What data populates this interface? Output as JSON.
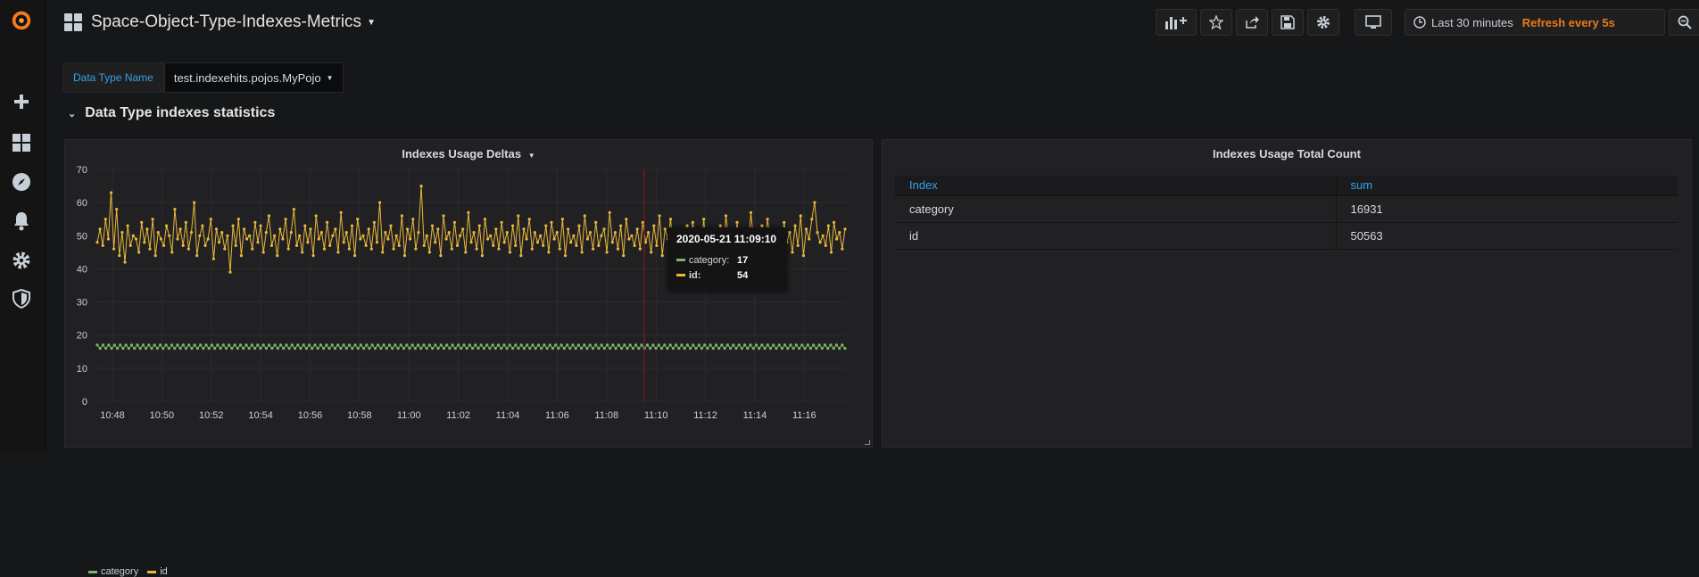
{
  "dashboard": {
    "title": "Space-Object-Type-Indexes-Metrics"
  },
  "topbar": {
    "time_range": "Last 30 minutes",
    "refresh": "Refresh every 5s"
  },
  "variables": {
    "label": "Data Type Name",
    "value": "test.indexehits.pojos.MyPojo"
  },
  "row": {
    "title": "Data Type indexes statistics"
  },
  "graph_panel": {
    "title": "Indexes Usage Deltas"
  },
  "table_panel": {
    "title": "Indexes Usage Total Count",
    "columns": [
      "Index",
      "sum"
    ],
    "rows": [
      [
        "category",
        "16931"
      ],
      [
        "id",
        "50563"
      ]
    ]
  },
  "tooltip": {
    "time": "2020-05-21 11:09:10",
    "rows": [
      {
        "name": "category:",
        "value": "17",
        "color": "#7eb26d"
      },
      {
        "name": "id:",
        "value": "54",
        "color": "#eab839"
      }
    ]
  },
  "colors": {
    "category": "#7eb26d",
    "id": "#eab839",
    "accent": "#33a2e5",
    "refresh": "#eb7b18"
  },
  "chart_data": {
    "type": "line",
    "title": "Indexes Usage Deltas",
    "x_ticks": [
      "10:48",
      "10:50",
      "10:52",
      "10:54",
      "10:56",
      "10:58",
      "11:00",
      "11:02",
      "11:04",
      "11:06",
      "11:08",
      "11:10",
      "11:12",
      "11:14",
      "11:16"
    ],
    "y_ticks": [
      0,
      10,
      20,
      30,
      40,
      50,
      60,
      70
    ],
    "ylim": [
      0,
      70
    ],
    "grid": true,
    "legend_position": "bottom-left",
    "series": [
      {
        "name": "category",
        "color": "#7eb26d",
        "values": [
          17,
          16,
          17,
          16,
          17,
          16,
          17,
          16,
          17,
          16,
          17,
          16,
          17,
          16,
          17,
          16,
          17,
          16,
          17,
          16,
          17,
          16,
          17,
          16,
          17,
          16,
          17,
          16,
          17,
          16,
          17,
          16,
          17,
          16,
          17,
          16,
          17,
          16,
          17,
          16,
          17,
          16,
          17,
          16,
          17,
          16,
          17,
          16,
          17,
          16,
          17,
          16,
          17,
          16,
          17,
          16,
          17,
          16,
          17,
          16,
          17,
          16,
          17,
          16,
          17,
          16,
          17,
          16,
          17,
          16,
          17,
          16,
          17,
          16,
          17,
          16,
          17,
          16,
          17,
          16,
          17,
          16,
          17,
          16,
          17,
          16,
          17,
          16,
          17,
          16,
          17,
          16,
          17,
          16,
          17,
          16,
          17,
          16,
          17,
          16,
          17,
          16,
          17,
          16,
          17,
          16,
          17,
          16,
          17,
          16,
          17,
          16,
          17,
          16,
          17,
          16,
          17,
          16,
          17,
          16,
          17,
          16,
          17,
          16,
          17,
          16,
          17,
          16,
          17,
          16,
          17,
          16,
          17,
          16,
          17,
          16,
          17,
          16,
          17,
          16,
          17,
          16,
          17,
          16,
          17,
          16,
          17,
          16,
          17,
          16,
          17,
          16,
          17,
          16,
          17,
          16,
          17,
          16,
          17,
          16,
          17,
          16,
          17,
          16,
          17,
          16,
          17,
          16,
          17,
          16,
          17,
          16,
          17,
          16,
          17,
          16,
          17,
          16,
          17,
          16,
          17,
          16,
          17,
          16,
          17,
          16,
          17,
          16,
          17,
          16,
          17,
          16,
          17,
          16,
          17,
          16,
          17,
          16,
          17,
          16,
          17,
          16,
          17,
          16,
          17,
          16,
          17,
          16,
          17,
          16,
          17,
          16,
          17,
          16,
          17,
          16,
          17,
          16,
          17,
          16,
          17,
          16,
          17,
          16,
          17,
          16,
          17,
          16,
          17,
          16,
          17,
          16,
          17,
          16,
          17,
          16,
          17,
          16,
          17,
          16,
          17,
          16,
          17,
          16,
          17,
          16,
          17,
          16,
          17,
          16,
          17,
          16,
          17,
          16,
          17,
          16,
          17,
          16,
          17,
          16,
          17,
          16
        ]
      },
      {
        "name": "id",
        "color": "#eab839",
        "values": [
          48,
          52,
          47,
          55,
          49,
          63,
          46,
          58,
          44,
          51,
          42,
          53,
          47,
          50,
          49,
          45,
          54,
          48,
          52,
          46,
          55,
          44,
          51,
          49,
          47,
          53,
          50,
          45,
          58,
          49,
          52,
          47,
          54,
          46,
          51,
          60,
          44,
          50,
          53,
          47,
          49,
          55,
          43,
          52,
          48,
          51,
          46,
          50,
          39,
          53,
          47,
          55,
          44,
          52,
          49,
          50,
          46,
          54,
          48,
          53,
          45,
          51,
          56,
          47,
          50,
          44,
          52,
          49,
          55,
          46,
          51,
          58,
          47,
          50,
          45,
          53,
          48,
          52,
          44,
          56,
          49,
          51,
          46,
          54,
          47,
          50,
          52,
          45,
          57,
          48,
          51,
          46,
          53,
          44,
          55,
          49,
          50,
          47,
          52,
          46,
          54,
          48,
          60,
          45,
          51,
          49,
          53,
          46,
          50,
          47,
          56,
          44,
          52,
          49,
          55,
          46,
          51,
          65,
          47,
          50,
          45,
          53,
          48,
          52,
          44,
          56,
          49,
          51,
          46,
          54,
          47,
          50,
          52,
          45,
          57,
          48,
          51,
          46,
          53,
          44,
          55,
          49,
          50,
          47,
          52,
          46,
          54,
          48,
          51,
          45,
          53,
          47,
          56,
          44,
          52,
          49,
          55,
          46,
          51,
          48,
          50,
          47,
          53,
          45,
          54,
          49,
          51,
          46,
          55,
          44,
          52,
          48,
          50,
          47,
          53,
          45,
          56,
          49,
          51,
          46,
          54,
          47,
          50,
          52,
          45,
          57,
          48,
          51,
          46,
          53,
          44,
          55,
          49,
          50,
          47,
          52,
          46,
          54,
          48,
          51,
          45,
          53,
          47,
          56,
          44,
          52,
          49,
          55,
          46,
          51,
          48,
          50,
          47,
          53,
          45,
          54,
          49,
          51,
          46,
          55,
          44,
          52,
          48,
          50,
          47,
          53,
          45,
          56,
          49,
          51,
          46,
          54,
          47,
          50,
          52,
          45,
          57,
          48,
          51,
          46,
          53,
          44,
          55,
          49,
          50,
          47,
          52,
          46,
          54,
          48,
          51,
          45,
          53,
          47,
          56,
          44,
          52,
          49,
          55,
          60,
          51,
          48,
          50,
          47,
          53,
          45,
          54,
          49,
          51,
          46,
          52
        ]
      }
    ]
  }
}
